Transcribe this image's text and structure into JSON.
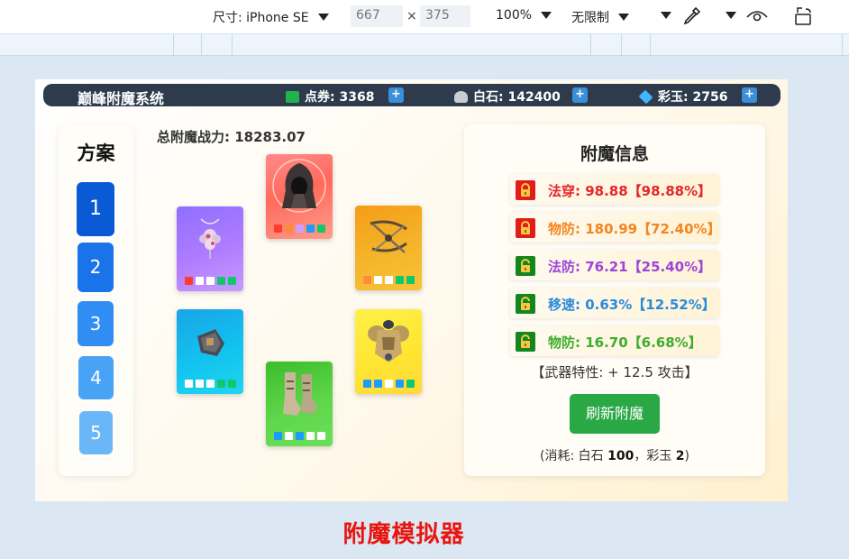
{
  "devtools": {
    "size_label": "尺寸: iPhone SE",
    "width": "667",
    "times": "×",
    "height": "375",
    "zoom": "100%",
    "throttle": "无限制"
  },
  "header": {
    "title": "巅峰附魔系统",
    "points_label": "点券: 3368",
    "stone_label": "白石: 142400",
    "jade_label": "彩玉: 2756",
    "plus": "+"
  },
  "plans": {
    "title": "方案",
    "items": [
      "1",
      "2",
      "3",
      "4",
      "5"
    ],
    "selected": "1"
  },
  "power": "总附魔战力: 18283.07",
  "equipment": [
    {
      "name": "hood",
      "colors": [
        "#ff3b30",
        "#ff8a3d",
        "#d59cff",
        "#1e9bff",
        "#12c76b"
      ]
    },
    {
      "name": "necklace",
      "colors": [
        "#ff3b30",
        "#ffffff",
        "#ffffff",
        "#12c76b",
        "#12c76b"
      ]
    },
    {
      "name": "crossbow",
      "colors": [
        "#ff8a3d",
        "#ffffff",
        "#ffffff",
        "#12c76b",
        "#12c76b"
      ]
    },
    {
      "name": "gauntlet",
      "colors": [
        "#ffffff",
        "#ffffff",
        "#ffffff",
        "#12c76b",
        "#12c76b"
      ]
    },
    {
      "name": "armor",
      "colors": [
        "#1e9bff",
        "#1e9bff",
        "#ffffff",
        "#1e9bff",
        "#12c76b"
      ]
    },
    {
      "name": "boots",
      "colors": [
        "#1e9bff",
        "#ffffff",
        "#1e9bff",
        "#ffffff",
        "#ffffff"
      ]
    }
  ],
  "info": {
    "title": "附魔信息",
    "attributes": [
      {
        "text": "法穿: 98.88【98.88%】",
        "color": "#e5262b",
        "locked": true
      },
      {
        "text": "物防: 180.99【72.40%】",
        "color": "#f2861e",
        "locked": true
      },
      {
        "text": "法防: 76.21【25.40%】",
        "color": "#9b46d6",
        "locked": false
      },
      {
        "text": "移速: 0.63%【12.52%】",
        "color": "#2b8ad9",
        "locked": false
      },
      {
        "text": "物防: 16.70【6.68%】",
        "color": "#3cae2e",
        "locked": false
      }
    ],
    "weapon_trait": "【武器特性: + 12.5 攻击】",
    "refresh": "刷新附魔",
    "cost_prefix": "(消耗: 白石 ",
    "cost_stone": "100",
    "cost_mid": "，彩玉 ",
    "cost_jade": "2",
    "cost_suffix": ")"
  },
  "footer_title": "附魔模拟器"
}
